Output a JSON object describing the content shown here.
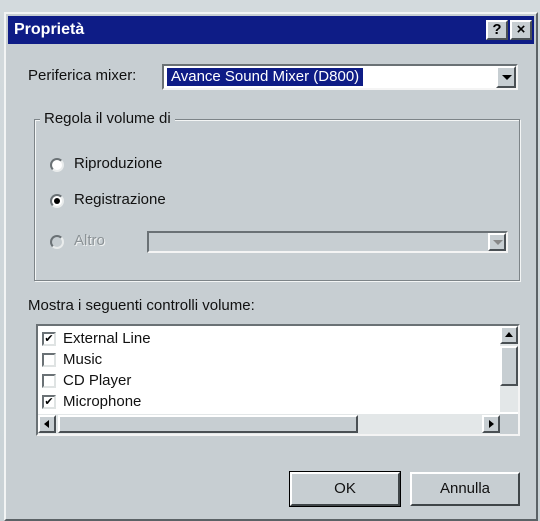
{
  "window": {
    "title": "Proprietà",
    "help_label": "?",
    "close_label": "×"
  },
  "mixer": {
    "label": "Periferica mixer:",
    "selected": "Avance Sound Mixer (D800)"
  },
  "volume_group": {
    "title": "Regola il volume di",
    "options": [
      {
        "label": "Riproduzione",
        "selected": false,
        "enabled": true
      },
      {
        "label": "Registrazione",
        "selected": true,
        "enabled": true
      },
      {
        "label": "Altro",
        "selected": false,
        "enabled": false
      }
    ]
  },
  "controls": {
    "label": "Mostra i seguenti controlli volume:",
    "items": [
      {
        "label": "External Line",
        "checked": true
      },
      {
        "label": "Music",
        "checked": false
      },
      {
        "label": "CD Player",
        "checked": false
      },
      {
        "label": "Microphone",
        "checked": true
      }
    ]
  },
  "buttons": {
    "ok": "OK",
    "cancel": "Annulla"
  },
  "colors": {
    "titlebar": "#0e1c86",
    "face": "#c7ced2",
    "selection": "#0e1c86"
  }
}
